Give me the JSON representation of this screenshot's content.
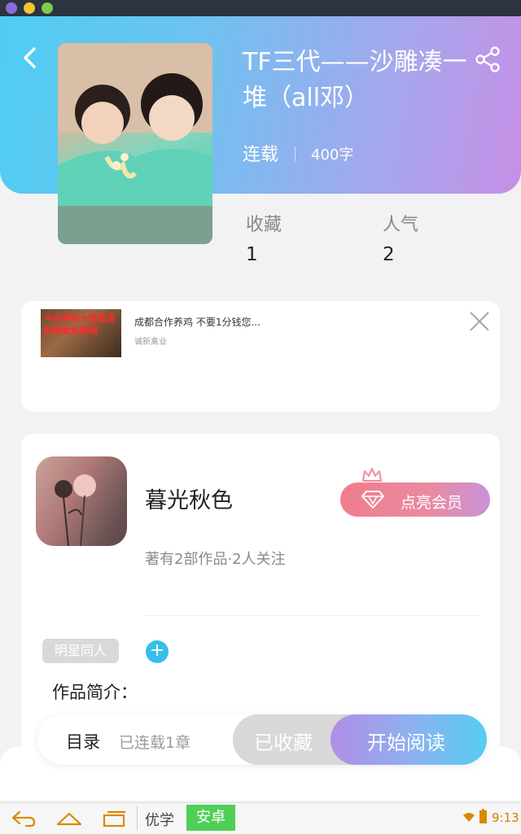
{
  "book": {
    "title": "TF三代——沙雕凑一堆（all邓）",
    "status": "连载",
    "word_count": "400字"
  },
  "stats": {
    "favorites_label": "收藏",
    "favorites_value": "1",
    "popularity_label": "人气",
    "popularity_value": "2"
  },
  "ad": {
    "thumb_text": "今年养鸡大家都发财那就免费领",
    "title": "成都合作养鸡 不要1分钱您...",
    "source": "诚新禽业"
  },
  "author": {
    "name": "暮光秋色",
    "vip_label": "点亮会员",
    "meta": "著有2部作品·2人关注",
    "tag": "明星同人",
    "add_tag": "+",
    "intro_label": "作品简介："
  },
  "action_bar": {
    "toc_label": "目录",
    "toc_status": "已连载1章",
    "collected_label": "已收藏",
    "read_label": "开始阅读"
  },
  "system_nav": {
    "app1": "优学",
    "app2": "安卓",
    "time": "9:13"
  },
  "colors": {
    "header_gradient_start": "#4fcdf3",
    "header_gradient_end": "#c68fe6",
    "accent_blue": "#35bfea"
  },
  "icons": [
    "back-icon",
    "share-icon",
    "close-icon",
    "crown-icon",
    "diamond-icon",
    "nav-back-icon",
    "nav-home-icon",
    "nav-recent-icon",
    "wifi-icon",
    "battery-icon"
  ]
}
